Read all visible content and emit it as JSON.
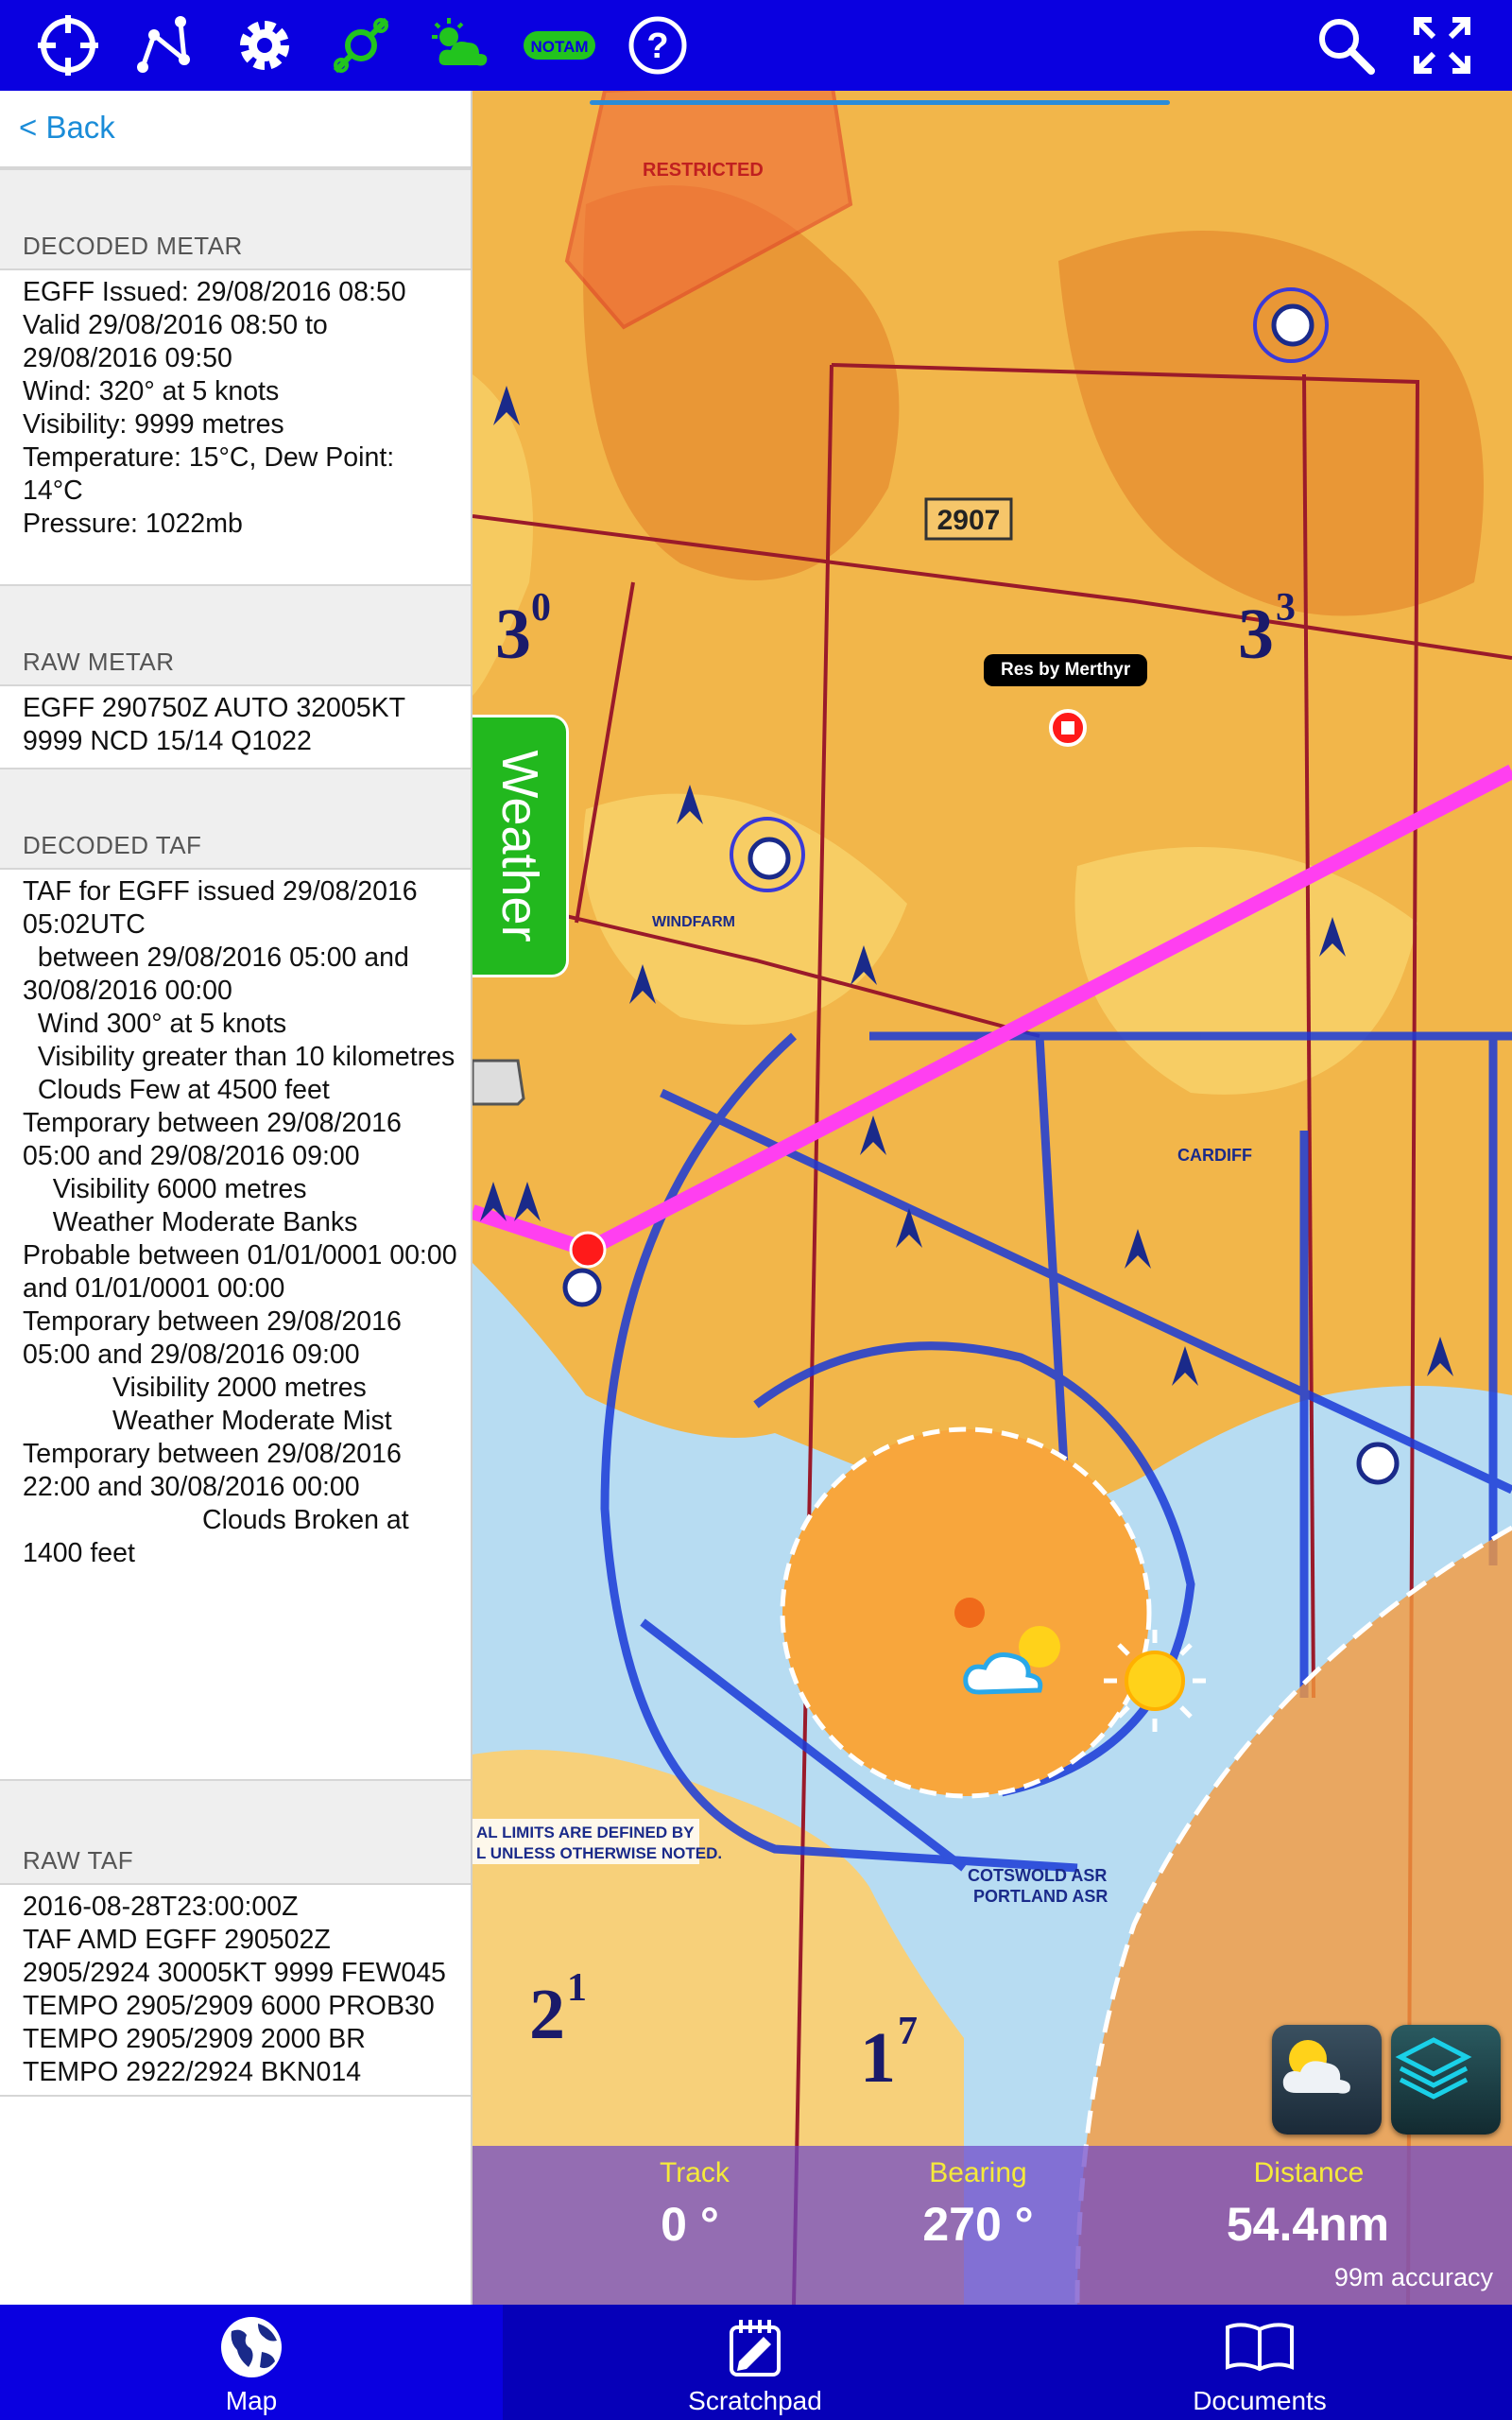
{
  "toolbar": {
    "left_icons": [
      "crosshair-icon",
      "route-icon",
      "gear-icon",
      "plates-icon",
      "weather-cloud-icon",
      "notam-icon",
      "help-icon"
    ],
    "notam_label": "NOTAM",
    "right_icons": [
      "search-icon",
      "fullscreen-icon"
    ]
  },
  "panel": {
    "back_label": "< Back",
    "decoded_metar_title": "DECODED METAR",
    "decoded_metar_text": "EGFF Issued: 29/08/2016 08:50\nValid 29/08/2016 08:50 to 29/08/2016 09:50\nWind: 320° at 5 knots\nVisibility: 9999 metres\nTemperature: 15°C, Dew Point: 14°C\nPressure: 1022mb",
    "raw_metar_title": "RAW METAR",
    "raw_metar_text": "EGFF 290750Z AUTO 32005KT 9999 NCD 15/14 Q1022",
    "decoded_taf_title": "DECODED TAF",
    "decoded_taf_text": "TAF for EGFF issued 29/08/2016 05:02UTC\n  between 29/08/2016 05:00 and 30/08/2016 00:00\n  Wind 300° at 5 knots\n  Visibility greater than 10 kilometres\n  Clouds Few at 4500 feet\nTemporary between 29/08/2016 05:00 and 29/08/2016 09:00\n    Visibility 6000 metres\n    Weather Moderate Banks\nProbable between 01/01/0001 00:00 and 01/01/0001 00:00\nTemporary between 29/08/2016 05:00 and 29/08/2016 09:00\n            Visibility 2000 metres\n            Weather Moderate Mist\nTemporary between 29/08/2016 22:00 and 30/08/2016 00:00\n                        Clouds Broken at 1400 feet",
    "raw_taf_title": "RAW TAF",
    "raw_taf_text": "2016-08-28T23:00:00Z\nTAF AMD EGFF 290502Z 2905/2924 30005KT 9999 FEW045 TEMPO 2905/2909 6000 PROB30 TEMPO 2905/2909 2000 BR TEMPO 2922/2924 BKN014"
  },
  "map": {
    "weather_tab_label": "Weather",
    "waypoint_label": "Res by Merthyr",
    "labels": [
      "2907",
      "RESTRICTED",
      "WINDFARM",
      "CARDIFF",
      "COTSWOLD ASR",
      "PORTLAND ASR",
      "AL LIMITS ARE DEFINED BY",
      "L UNLESS OTHERWISE NOTED."
    ],
    "sector_labels": [
      "3",
      "0",
      "3",
      "3",
      "2",
      "1",
      "1",
      "7"
    ],
    "colors": {
      "route": "#ff3ff0",
      "cta": "#1a3ad8",
      "sea": "#b7dcf2",
      "terrain": "#f2b64a",
      "weather_circle": "#f8a63c"
    },
    "readout": {
      "track_label": "Track",
      "track_value": "0 °",
      "bearing_label": "Bearing",
      "bearing_value": "270 °",
      "distance_label": "Distance",
      "distance_value": "54.4nm",
      "accuracy": "99m accuracy"
    },
    "buttons": [
      "weather-overlay-icon",
      "layers-icon"
    ]
  },
  "bottom_nav": {
    "items": [
      {
        "label": "Map",
        "icon": "globe-icon",
        "active": true
      },
      {
        "label": "Scratchpad",
        "icon": "scratchpad-icon",
        "active": false
      },
      {
        "label": "Documents",
        "icon": "book-icon",
        "active": false
      }
    ]
  }
}
